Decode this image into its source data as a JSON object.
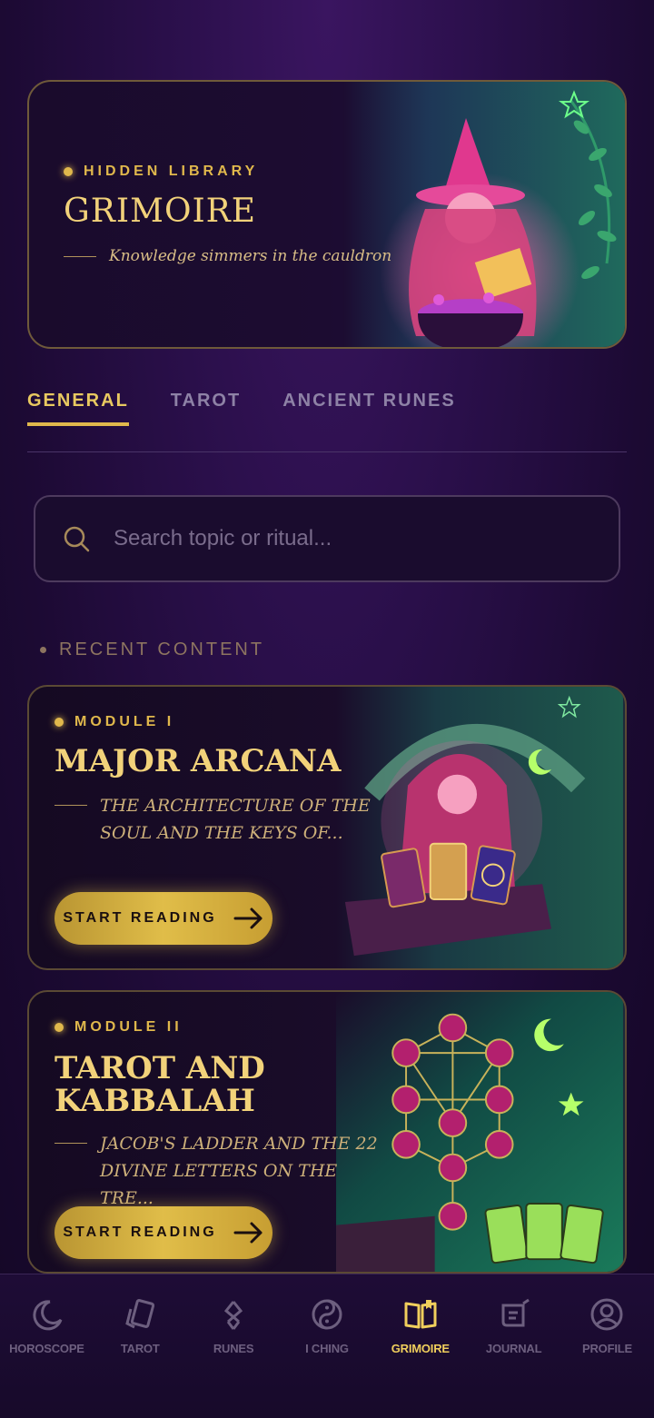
{
  "hero": {
    "eyebrow": "HIDDEN LIBRARY",
    "title": "GRIMOIRE",
    "subtitle": "Knowledge simmers in the cauldron"
  },
  "tabs": [
    {
      "label": "GENERAL",
      "active": true
    },
    {
      "label": "TAROT",
      "active": false
    },
    {
      "label": "ANCIENT RUNES",
      "active": false
    }
  ],
  "search": {
    "placeholder": "Search topic or ritual..."
  },
  "section": {
    "label": "RECENT CONTENT"
  },
  "modules": [
    {
      "eyebrow": "MODULE I",
      "title": "MAJOR ARCANA",
      "description": "THE ARCHITECTURE OF THE SOUL AND THE KEYS OF...",
      "button": "START READING"
    },
    {
      "eyebrow": "MODULE II",
      "title": "TAROT AND KABBALAH",
      "description": "JACOB'S LADDER AND THE 22 DIVINE LETTERS ON THE TRE...",
      "button": "START READING"
    }
  ],
  "nav": [
    {
      "label": "HOROSCOPE",
      "icon": "moon-icon",
      "active": false
    },
    {
      "label": "TAROT",
      "icon": "cards-icon",
      "active": false
    },
    {
      "label": "RUNES",
      "icon": "rune-icon",
      "active": false
    },
    {
      "label": "I CHING",
      "icon": "yin-yang-icon",
      "active": false
    },
    {
      "label": "GRIMOIRE",
      "icon": "book-icon",
      "active": true
    },
    {
      "label": "JOURNAL",
      "icon": "journal-icon",
      "active": false
    },
    {
      "label": "PROFILE",
      "icon": "profile-icon",
      "active": false
    }
  ],
  "colors": {
    "accent": "#e0b84c",
    "background": "#1c0a33",
    "muted": "#6d5f7f"
  }
}
